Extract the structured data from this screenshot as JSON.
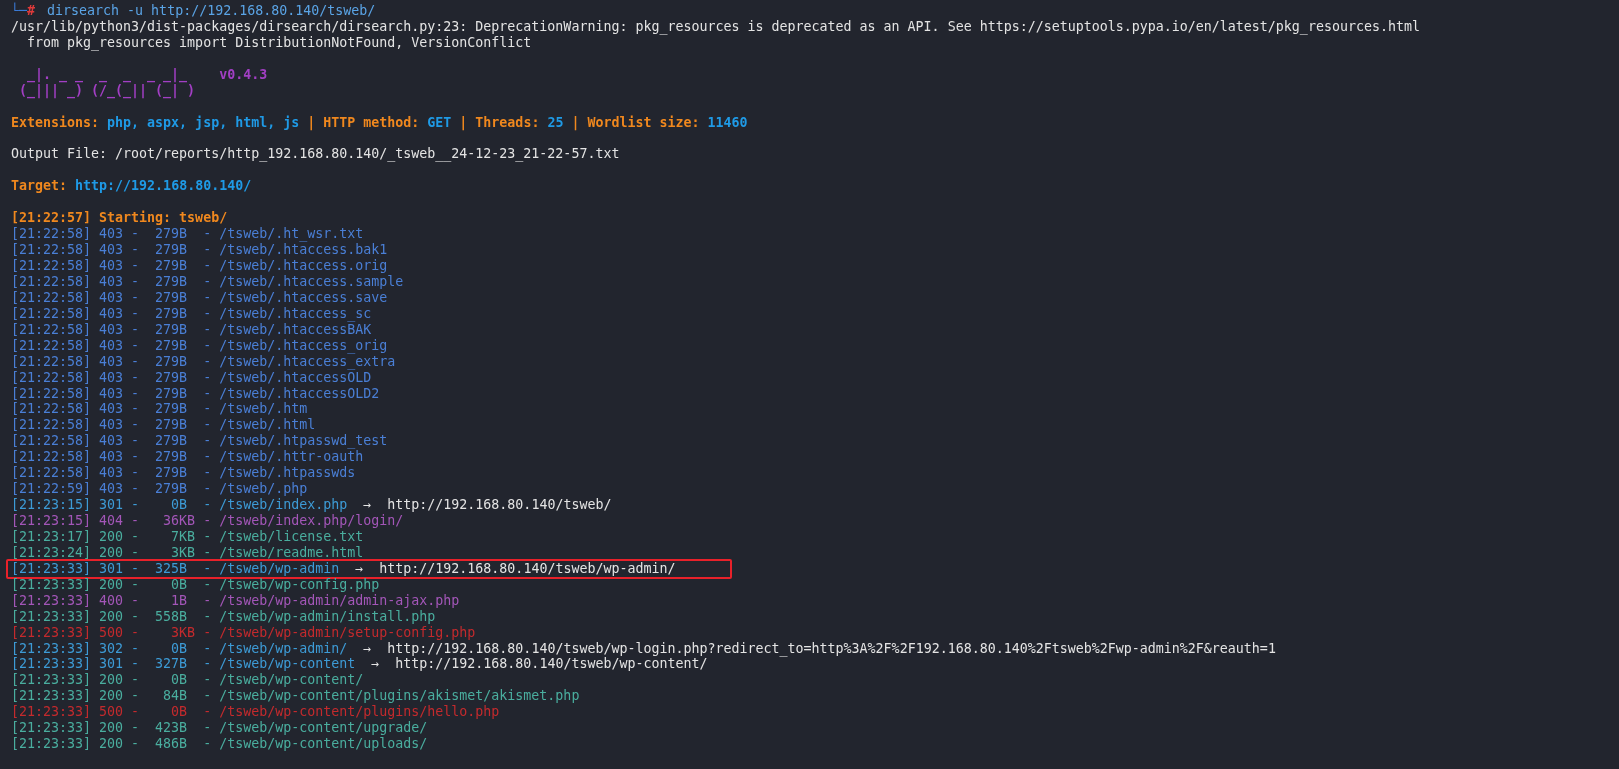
{
  "prompt": {
    "branch": "└─",
    "symbol": "#",
    "command": "dirsearch -u http://192.168.80.140/tsweb/"
  },
  "warning_lines": [
    "/usr/lib/python3/dist-packages/dirsearch/dirsearch.py:23: DeprecationWarning: pkg_resources is deprecated as an API. See https://setuptools.pypa.io/en/latest/pkg_resources.html",
    "  from pkg_resources import DistributionNotFound, VersionConflict"
  ],
  "banner": {
    "lines": [
      "  _|. _ _  _  _  _ _|_",
      " (_||| _) (/_(_|| (_| )"
    ],
    "version": "v0.4.3"
  },
  "config": [
    {
      "kind": "label",
      "text": "Extensions:"
    },
    {
      "kind": "value",
      "text": "php, aspx, jsp, html, js"
    },
    {
      "kind": "sep",
      "text": "|"
    },
    {
      "kind": "label",
      "text": "HTTP method:"
    },
    {
      "kind": "value",
      "text": "GET"
    },
    {
      "kind": "sep",
      "text": "|"
    },
    {
      "kind": "label",
      "text": "Threads:"
    },
    {
      "kind": "value",
      "text": "25"
    },
    {
      "kind": "sep",
      "text": "|"
    },
    {
      "kind": "label",
      "text": "Wordlist size:"
    },
    {
      "kind": "value",
      "text": "11460"
    }
  ],
  "output_file": "Output File: /root/reports/http_192.168.80.140/_tsweb__24-12-23_21-22-57.txt",
  "target": {
    "label": "Target:",
    "value": "http://192.168.80.140/"
  },
  "start_line": "[21:22:57] Starting: tsweb/",
  "rows": [
    {
      "line": "[21:22:58] 403 -  279B  - /tsweb/.ht_wsr.txt",
      "color": "#4a7fd6",
      "highlighted": false
    },
    {
      "line": "[21:22:58] 403 -  279B  - /tsweb/.htaccess.bak1",
      "color": "#4a7fd6",
      "highlighted": false
    },
    {
      "line": "[21:22:58] 403 -  279B  - /tsweb/.htaccess.orig",
      "color": "#4a7fd6",
      "highlighted": false
    },
    {
      "line": "[21:22:58] 403 -  279B  - /tsweb/.htaccess.sample",
      "color": "#4a7fd6",
      "highlighted": false
    },
    {
      "line": "[21:22:58] 403 -  279B  - /tsweb/.htaccess.save",
      "color": "#4a7fd6",
      "highlighted": false
    },
    {
      "line": "[21:22:58] 403 -  279B  - /tsweb/.htaccess_sc",
      "color": "#4a7fd6",
      "highlighted": false
    },
    {
      "line": "[21:22:58] 403 -  279B  - /tsweb/.htaccessBAK",
      "color": "#4a7fd6",
      "highlighted": false
    },
    {
      "line": "[21:22:58] 403 -  279B  - /tsweb/.htaccess_orig",
      "color": "#4a7fd6",
      "highlighted": false
    },
    {
      "line": "[21:22:58] 403 -  279B  - /tsweb/.htaccess_extra",
      "color": "#4a7fd6",
      "highlighted": false
    },
    {
      "line": "[21:22:58] 403 -  279B  - /tsweb/.htaccessOLD",
      "color": "#4a7fd6",
      "highlighted": false
    },
    {
      "line": "[21:22:58] 403 -  279B  - /tsweb/.htaccessOLD2",
      "color": "#4a7fd6",
      "highlighted": false
    },
    {
      "line": "[21:22:58] 403 -  279B  - /tsweb/.htm",
      "color": "#4a7fd6",
      "highlighted": false
    },
    {
      "line": "[21:22:58] 403 -  279B  - /tsweb/.html",
      "color": "#4a7fd6",
      "highlighted": false
    },
    {
      "line": "[21:22:58] 403 -  279B  - /tsweb/.htpasswd_test",
      "color": "#4a7fd6",
      "highlighted": false
    },
    {
      "line": "[21:22:58] 403 -  279B  - /tsweb/.httr-oauth",
      "color": "#4a7fd6",
      "highlighted": false
    },
    {
      "line": "[21:22:58] 403 -  279B  - /tsweb/.htpasswds",
      "color": "#4a7fd6",
      "highlighted": false
    },
    {
      "line": "[21:22:59] 403 -  279B  - /tsweb/.php",
      "color": "#4a7fd6",
      "highlighted": false
    },
    {
      "line": "[21:23:15] 301 -    0B  - /tsweb/index.php",
      "arrow": "→",
      "redirect": "http://192.168.80.140/tsweb/",
      "color": "#3d9bd6",
      "highlighted": false
    },
    {
      "line": "[21:23:15] 404 -   36KB - /tsweb/index.php/login/",
      "color": "#a356b8",
      "highlighted": false
    },
    {
      "line": "[21:23:17] 200 -    7KB - /tsweb/license.txt",
      "color": "#4aae9f",
      "highlighted": false
    },
    {
      "line": "[21:23:24] 200 -    3KB - /tsweb/readme.html",
      "color": "#4aae9f",
      "highlighted": false
    },
    {
      "line": "[21:23:33] 301 -  325B  - /tsweb/wp-admin",
      "arrow": "→",
      "redirect": "http://192.168.80.140/tsweb/wp-admin/",
      "color": "#3d9bd6",
      "highlighted": true
    },
    {
      "line": "[21:23:33] 200 -    0B  - /tsweb/wp-config.php",
      "color": "#4aae9f",
      "highlighted": false
    },
    {
      "line": "[21:23:33] 400 -    1B  - /tsweb/wp-admin/admin-ajax.php",
      "color": "#a356b8",
      "highlighted": false
    },
    {
      "line": "[21:23:33] 200 -  558B  - /tsweb/wp-admin/install.php",
      "color": "#4aae9f",
      "highlighted": false
    },
    {
      "line": "[21:23:33] 500 -    3KB - /tsweb/wp-admin/setup-config.php",
      "color": "#c42a2d",
      "highlighted": false
    },
    {
      "line": "[21:23:33] 302 -    0B  - /tsweb/wp-admin/",
      "arrow": "→",
      "redirect": "http://192.168.80.140/tsweb/wp-login.php?redirect_to=http%3A%2F%2F192.168.80.140%2Ftsweb%2Fwp-admin%2F&reauth=1",
      "color": "#3d9bd6",
      "highlighted": false
    },
    {
      "line": "[21:23:33] 301 -  327B  - /tsweb/wp-content",
      "arrow": "→",
      "redirect": "http://192.168.80.140/tsweb/wp-content/",
      "color": "#3d9bd6",
      "highlighted": false
    },
    {
      "line": "[21:23:33] 200 -    0B  - /tsweb/wp-content/",
      "color": "#4aae9f",
      "highlighted": false
    },
    {
      "line": "[21:23:33] 200 -   84B  - /tsweb/wp-content/plugins/akismet/akismet.php",
      "color": "#4aae9f",
      "highlighted": false
    },
    {
      "line": "[21:23:33] 500 -    0B  - /tsweb/wp-content/plugins/hello.php",
      "color": "#c42a2d",
      "highlighted": false
    },
    {
      "line": "[21:23:33] 200 -  423B  - /tsweb/wp-content/upgrade/",
      "color": "#4aae9f",
      "highlighted": false
    },
    {
      "line": "[21:23:33] 200 -  486B  - /tsweb/wp-content/uploads/",
      "color": "#4aae9f",
      "highlighted": false
    }
  ]
}
